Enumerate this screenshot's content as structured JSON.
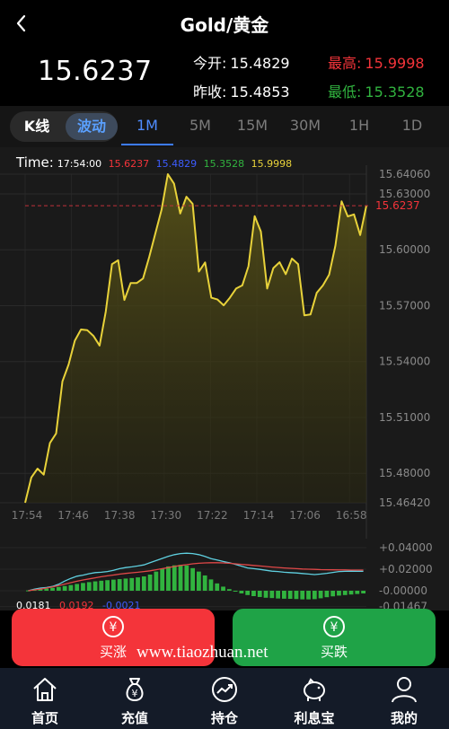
{
  "header": {
    "title": "Gold/黄金"
  },
  "price": {
    "current": "15.6237",
    "open_label": "今开:",
    "open": "15.4829",
    "high_label": "最高:",
    "high": "15.9998",
    "prev_close_label": "昨收:",
    "prev_close": "15.4853",
    "low_label": "最低:",
    "low": "15.3528"
  },
  "colors": {
    "up": "#f4343a",
    "down": "#1fa347",
    "accent": "#4f8cff",
    "line": "#e8d23a",
    "ma_blue": "#3d5cff",
    "ma_green": "#31b33f"
  },
  "tabs": {
    "kline": "K线",
    "wave": "波动",
    "timeframes": [
      "1M",
      "5M",
      "15M",
      "30M",
      "1H",
      "1D"
    ],
    "active": "1M"
  },
  "legend": {
    "label": "Time:",
    "time": "17:54:00",
    "v1": "15.6237",
    "v2": "15.4829",
    "v3": "15.3528",
    "v4": "15.9998"
  },
  "chart_data": {
    "type": "line",
    "title": "",
    "y_ticks": [
      "15.64060",
      "15.63000",
      "15.60000",
      "15.57000",
      "15.54000",
      "15.51000",
      "15.48000",
      "15.46420"
    ],
    "ylim": [
      15.4642,
      15.6406
    ],
    "current_marker": "15.6237",
    "x_ticks": [
      "17:54",
      "17:46",
      "17:38",
      "17:30",
      "17:22",
      "17:14",
      "17:06",
      "16:58"
    ],
    "series": [
      {
        "values": [
          15.4642,
          15.4778,
          15.4825,
          15.4793,
          15.4963,
          15.5014,
          15.5293,
          15.5384,
          15.5512,
          15.5572,
          15.5569,
          15.5538,
          15.5486,
          15.5669,
          15.5923,
          15.5944,
          15.5731,
          15.5822,
          15.5822,
          15.5846,
          15.5962,
          15.609,
          15.6217,
          15.6406,
          15.6355,
          15.6195,
          15.6285,
          15.6247,
          15.5883,
          15.5932,
          15.5743,
          15.5733,
          15.5702,
          15.5743,
          15.5792,
          15.5809,
          15.5912,
          15.6181,
          15.6098,
          15.5792,
          15.5902,
          15.5933,
          15.5869,
          15.5953,
          15.5923,
          15.5648,
          15.5653,
          15.5769,
          15.5809,
          15.5866,
          15.6023,
          15.626,
          15.6179,
          15.619,
          15.6079,
          15.6237
        ]
      }
    ],
    "macd_ticks": [
      "+0.04000",
      "+0.02000",
      "-0.00000",
      "-0.01467"
    ],
    "macd": {
      "dif": "0.0181",
      "dea": "0.0192",
      "macd": "-0.0021",
      "histogram": [
        0.0003,
        0.0008,
        0.0014,
        0.002,
        0.0027,
        0.0035,
        0.0044,
        0.0053,
        0.0063,
        0.0072,
        0.008,
        0.0087,
        0.0093,
        0.0098,
        0.0103,
        0.0108,
        0.0113,
        0.0118,
        0.0124,
        0.0133,
        0.015,
        0.0178,
        0.0205,
        0.0226,
        0.0236,
        0.024,
        0.0234,
        0.021,
        0.0178,
        0.0142,
        0.0105,
        0.0068,
        0.0038,
        0.0015,
        -0.0005,
        -0.0025,
        -0.004,
        -0.005,
        -0.0058,
        -0.0065,
        -0.0068,
        -0.0072,
        -0.0074,
        -0.0075,
        -0.0077,
        -0.008,
        -0.008,
        -0.0078,
        -0.007,
        -0.006,
        -0.0052,
        -0.0045,
        -0.004,
        -0.0035,
        -0.003,
        -0.0025
      ],
      "dif_line": [
        0.0,
        0.0015,
        0.0025,
        0.003,
        0.004,
        0.006,
        0.009,
        0.0115,
        0.0135,
        0.0145,
        0.0158,
        0.0168,
        0.0172,
        0.0178,
        0.019,
        0.0205,
        0.0215,
        0.0222,
        0.023,
        0.024,
        0.026,
        0.028,
        0.03,
        0.032,
        0.0335,
        0.0345,
        0.0348,
        0.0345,
        0.0335,
        0.0318,
        0.0298,
        0.0285,
        0.0272,
        0.026,
        0.0245,
        0.0228,
        0.0212,
        0.0205,
        0.0198,
        0.019,
        0.0182,
        0.0178,
        0.0172,
        0.0168,
        0.0165,
        0.016,
        0.0155,
        0.015,
        0.0155,
        0.0162,
        0.017,
        0.0178,
        0.018,
        0.0182,
        0.0181,
        0.0181
      ],
      "dea_line": [
        0.0,
        0.0008,
        0.0015,
        0.0025,
        0.0035,
        0.0048,
        0.0062,
        0.0075,
        0.0088,
        0.01,
        0.011,
        0.012,
        0.013,
        0.0138,
        0.0146,
        0.0154,
        0.0161,
        0.0167,
        0.0172,
        0.0178,
        0.0185,
        0.0195,
        0.0205,
        0.0215,
        0.0225,
        0.0235,
        0.0242,
        0.025,
        0.0255,
        0.0258,
        0.026,
        0.026,
        0.0258,
        0.0255,
        0.025,
        0.0245,
        0.024,
        0.0235,
        0.023,
        0.0225,
        0.022,
        0.0216,
        0.0212,
        0.0208,
        0.0205,
        0.0202,
        0.02,
        0.0198,
        0.0196,
        0.0195,
        0.0194,
        0.0193,
        0.0193,
        0.0192,
        0.0192,
        0.0192
      ]
    }
  },
  "buttons": {
    "buy_up": "买涨",
    "buy_down": "买跌",
    "currency_symbol": "¥"
  },
  "watermark": "www.tiaozhuan.net",
  "nav": {
    "items": [
      "首页",
      "充值",
      "持仓",
      "利息宝",
      "我的"
    ]
  }
}
